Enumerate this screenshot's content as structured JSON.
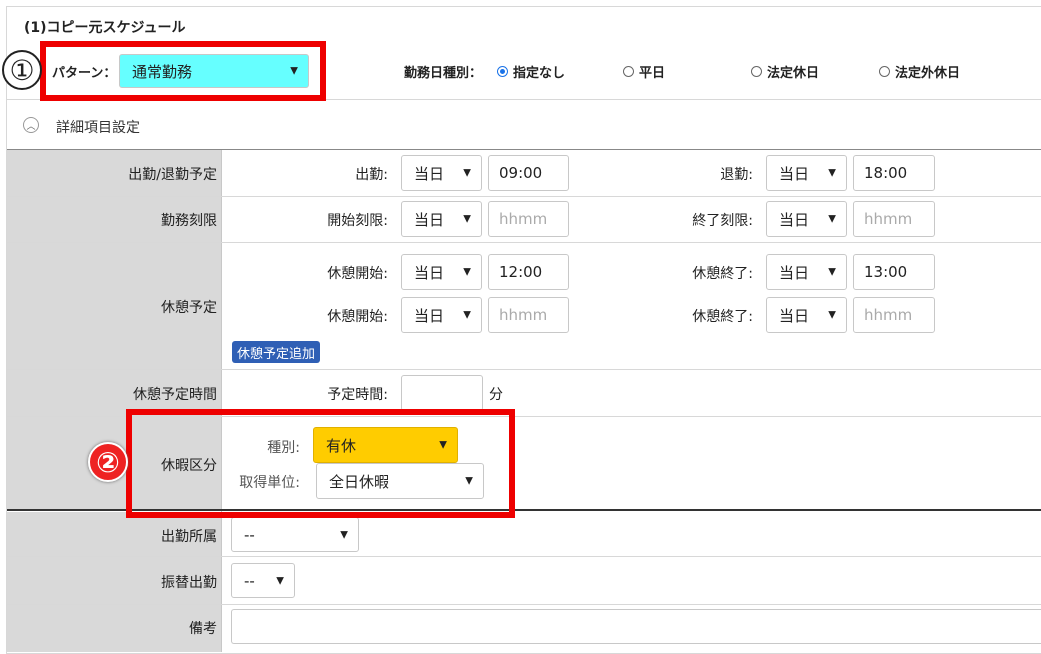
{
  "section_title": "(1)コピー元スケジュール",
  "pattern": {
    "label": "パターン：",
    "value": "通常勤務"
  },
  "work_day_type": {
    "label": "勤務日種別：",
    "options": [
      "指定なし",
      "平日",
      "法定休日",
      "法定外休日"
    ],
    "selected": "指定なし"
  },
  "detail_toggle_label": "詳細項目設定",
  "rows": {
    "attendance": {
      "label": "出勤/退勤予定",
      "start_label": "出勤:",
      "start_day": "当日",
      "start_time": "09:00",
      "end_label": "退勤:",
      "end_day": "当日",
      "end_time": "18:00"
    },
    "limit": {
      "label": "勤務刻限",
      "start_label": "開始刻限:",
      "start_day": "当日",
      "start_placeholder": "hhmm",
      "end_label": "終了刻限:",
      "end_day": "当日",
      "end_placeholder": "hhmm"
    },
    "break": {
      "label": "休憩予定",
      "entries": [
        {
          "start_label": "休憩開始:",
          "start_day": "当日",
          "start_time": "12:00",
          "end_label": "休憩終了:",
          "end_day": "当日",
          "end_time": "13:00"
        },
        {
          "start_label": "休憩開始:",
          "start_day": "当日",
          "start_placeholder": "hhmm",
          "end_label": "休憩終了:",
          "end_day": "当日",
          "end_placeholder": "hhmm"
        }
      ],
      "add_button": "休憩予定追加"
    },
    "break_time": {
      "label": "休憩予定時間",
      "field_label": "予定時間:",
      "value": "",
      "unit": "分"
    },
    "leave": {
      "label": "休暇区分",
      "type_label": "種別:",
      "type_value": "有休",
      "unit_label": "取得単位:",
      "unit_value": "全日休暇"
    },
    "dept": {
      "label": "出勤所属",
      "value": "--"
    },
    "substitute": {
      "label": "振替出勤",
      "value": "--"
    },
    "note": {
      "label": "備考",
      "value": ""
    }
  },
  "annotations": {
    "one": "①",
    "two": "②"
  },
  "colors": {
    "pattern_bg": "#66ffff",
    "leave_type_bg": "#ffcc00",
    "highlight_red": "#ee0000",
    "button_blue": "#2f5fb5",
    "label_col_bg": "#d9d9d9"
  }
}
